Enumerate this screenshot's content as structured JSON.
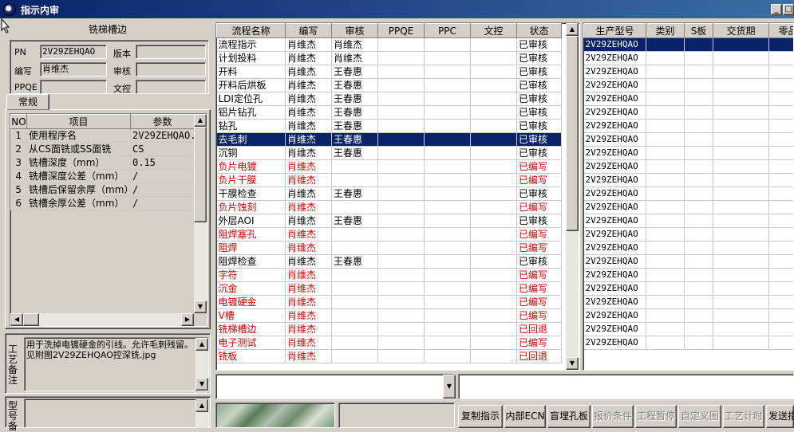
{
  "window": {
    "title": "指示内审",
    "min_label": "_",
    "max_label": "□"
  },
  "left": {
    "header": "铣梯槽边",
    "fields": {
      "pn_label": "PN",
      "pn_value": "2V29ZEHQAO",
      "version_label": "版本",
      "version_value": "",
      "writer_label": "编写",
      "writer_value": "肖维杰",
      "reviewer_label": "审核",
      "reviewer_value": "",
      "ppqe_label": "PPQE",
      "ppqe_value": "",
      "doc_control_label": "文控",
      "doc_control_value": ""
    },
    "tab": "常规",
    "param_table": {
      "headers": [
        "NO",
        "项目",
        "参数"
      ],
      "rows": [
        [
          "1",
          "使用程序名",
          "2V29ZEHQAO.RO"
        ],
        [
          "2",
          "从CS面铣或SS面铣",
          "CS"
        ],
        [
          "3",
          "铣槽深度（mm）",
          "0.15"
        ],
        [
          "4",
          "铣槽深度公差（mm）",
          "/"
        ],
        [
          "5",
          "铣槽后保留余厚（mm）",
          "/"
        ],
        [
          "6",
          "铣槽余厚公差（mm）",
          "/"
        ]
      ]
    },
    "process_note_label": "工艺备注",
    "process_note": "用于洗掉电镀硬金的引线。允许毛刺残留。\n见附图2V29ZEHQAO控深铣.jpg",
    "model_label": "型号备"
  },
  "flow": {
    "headers": [
      "流程名称",
      "编写",
      "审核",
      "PPQE",
      "PPC",
      "文控",
      "状态"
    ],
    "rows": [
      {
        "cells": [
          "流程指示",
          "肖维杰",
          "肖维杰",
          "",
          "",
          "",
          "已审核"
        ],
        "style": "normal"
      },
      {
        "cells": [
          "计划投料",
          "肖维杰",
          "肖维杰",
          "",
          "",
          "",
          "已审核"
        ],
        "style": "normal"
      },
      {
        "cells": [
          "开料",
          "肖维杰",
          "王春惠",
          "",
          "",
          "",
          "已审核"
        ],
        "style": "normal"
      },
      {
        "cells": [
          "开料后烘板",
          "肖维杰",
          "王春惠",
          "",
          "",
          "",
          "已审核"
        ],
        "style": "normal"
      },
      {
        "cells": [
          "LDI定位孔",
          "肖维杰",
          "王春惠",
          "",
          "",
          "",
          "已审核"
        ],
        "style": "normal"
      },
      {
        "cells": [
          "铝片钻孔",
          "肖维杰",
          "王春惠",
          "",
          "",
          "",
          "已审核"
        ],
        "style": "normal"
      },
      {
        "cells": [
          "钻孔",
          "肖维杰",
          "王春惠",
          "",
          "",
          "",
          "已审核"
        ],
        "style": "normal"
      },
      {
        "cells": [
          "去毛刺",
          "肖维杰",
          "王春惠",
          "",
          "",
          "",
          "已审核"
        ],
        "style": "selected"
      },
      {
        "cells": [
          "沉铜",
          "肖维杰",
          "王春惠",
          "",
          "",
          "",
          "已审核"
        ],
        "style": "normal"
      },
      {
        "cells": [
          "负片电镀",
          "肖维杰",
          "",
          "",
          "",
          "",
          "已编写"
        ],
        "style": "red"
      },
      {
        "cells": [
          "负片干膜",
          "肖维杰",
          "",
          "",
          "",
          "",
          "已编写"
        ],
        "style": "red"
      },
      {
        "cells": [
          "干膜检查",
          "肖维杰",
          "王春惠",
          "",
          "",
          "",
          "已审核"
        ],
        "style": "normal"
      },
      {
        "cells": [
          "负片蚀刻",
          "肖维杰",
          "",
          "",
          "",
          "",
          "已编写"
        ],
        "style": "red"
      },
      {
        "cells": [
          "外层AOI",
          "肖维杰",
          "王春惠",
          "",
          "",
          "",
          "已审核"
        ],
        "style": "normal"
      },
      {
        "cells": [
          "阻焊塞孔",
          "肖维杰",
          "",
          "",
          "",
          "",
          "已编写"
        ],
        "style": "red"
      },
      {
        "cells": [
          "阻焊",
          "肖维杰",
          "",
          "",
          "",
          "",
          "已编写"
        ],
        "style": "red"
      },
      {
        "cells": [
          "阻焊检查",
          "肖维杰",
          "王春惠",
          "",
          "",
          "",
          "已审核"
        ],
        "style": "normal"
      },
      {
        "cells": [
          "字符",
          "肖维杰",
          "",
          "",
          "",
          "",
          "已编写"
        ],
        "style": "red"
      },
      {
        "cells": [
          "沉金",
          "肖维杰",
          "",
          "",
          "",
          "",
          "已编写"
        ],
        "style": "red"
      },
      {
        "cells": [
          "电镀硬金",
          "肖维杰",
          "",
          "",
          "",
          "",
          "已编写"
        ],
        "style": "red"
      },
      {
        "cells": [
          "V槽",
          "肖维杰",
          "",
          "",
          "",
          "",
          "已编写"
        ],
        "style": "red"
      },
      {
        "cells": [
          "铣梯槽边",
          "肖维杰",
          "",
          "",
          "",
          "",
          "已回退"
        ],
        "style": "red"
      },
      {
        "cells": [
          "电子测试",
          "肖维杰",
          "",
          "",
          "",
          "",
          "已编写"
        ],
        "style": "red"
      },
      {
        "cells": [
          "铣板",
          "肖维杰",
          "",
          "",
          "",
          "",
          "已回退"
        ],
        "style": "red"
      }
    ]
  },
  "right": {
    "headers": [
      "生产型号",
      "类别",
      "S板",
      "交货期",
      "零品"
    ],
    "model": "2V29ZEHQAO",
    "row_count": 23
  },
  "buttons": [
    "复制指示",
    "内部ECN",
    "盲埋孔板",
    "报价条件",
    "工程暂停",
    "自定义图",
    "工艺计时",
    "发送指"
  ],
  "buttons_disabled": [
    false,
    false,
    false,
    true,
    true,
    true,
    true,
    false
  ],
  "colors": {
    "selection": "#0a246a",
    "pending_text": "#e00000",
    "title_gradient_start": "#0a246a",
    "title_gradient_end": "#3a6ea5"
  }
}
